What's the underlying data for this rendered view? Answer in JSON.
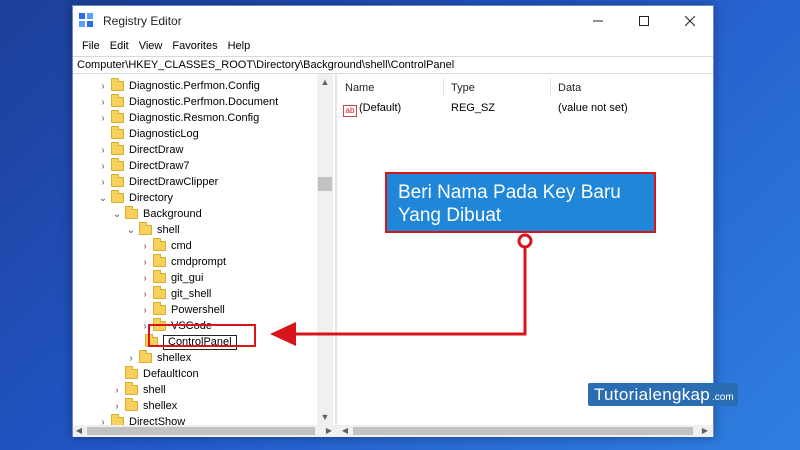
{
  "window": {
    "title": "Registry Editor"
  },
  "menu": [
    "File",
    "Edit",
    "View",
    "Favorites",
    "Help"
  ],
  "address": "Computer\\HKEY_CLASSES_ROOT\\Directory\\Background\\shell\\ControlPanel",
  "tree": [
    {
      "label": "Diagnostic.Perfmon.Config",
      "chevron": "›"
    },
    {
      "label": "Diagnostic.Perfmon.Document",
      "chevron": "›"
    },
    {
      "label": "Diagnostic.Resmon.Config",
      "chevron": "›"
    },
    {
      "label": "DiagnosticLog",
      "chevron": ""
    },
    {
      "label": "DirectDraw",
      "chevron": "›"
    },
    {
      "label": "DirectDraw7",
      "chevron": "›"
    },
    {
      "label": "DirectDrawClipper",
      "chevron": "›"
    },
    {
      "label": "Directory",
      "chevron": "⌄"
    },
    {
      "label": "Background",
      "chevron": "⌄"
    },
    {
      "label": "shell",
      "chevron": "⌄"
    },
    {
      "label": "cmd",
      "chevron": "›"
    },
    {
      "label": "cmdprompt",
      "chevron": "›"
    },
    {
      "label": "git_gui",
      "chevron": "›"
    },
    {
      "label": "git_shell",
      "chevron": "›"
    },
    {
      "label": "Powershell",
      "chevron": "›"
    },
    {
      "label": "VSCode",
      "chevron": "›"
    },
    {
      "label": "ControlPanel",
      "chevron": "",
      "editing": true
    },
    {
      "label": "shellex",
      "chevron": "›"
    },
    {
      "label": "DefaultIcon",
      "chevron": ""
    },
    {
      "label": "shell",
      "chevron": "›"
    },
    {
      "label": "shellex",
      "chevron": "›"
    },
    {
      "label": "DirectShow",
      "chevron": "›"
    }
  ],
  "columns": {
    "name": "Name",
    "type": "Type",
    "data": "Data"
  },
  "values": [
    {
      "icon": "ab",
      "name": "(Default)",
      "type": "REG_SZ",
      "data": "(value not set)"
    }
  ],
  "callout": {
    "text": "Beri Nama Pada Key Baru Yang Dibuat"
  },
  "watermark": {
    "main": "Tutorialengkap",
    "tld": ".com"
  },
  "colors": {
    "accent": "#1f86d8",
    "highlight": "#d8151b",
    "folder": "#f7d15b"
  }
}
